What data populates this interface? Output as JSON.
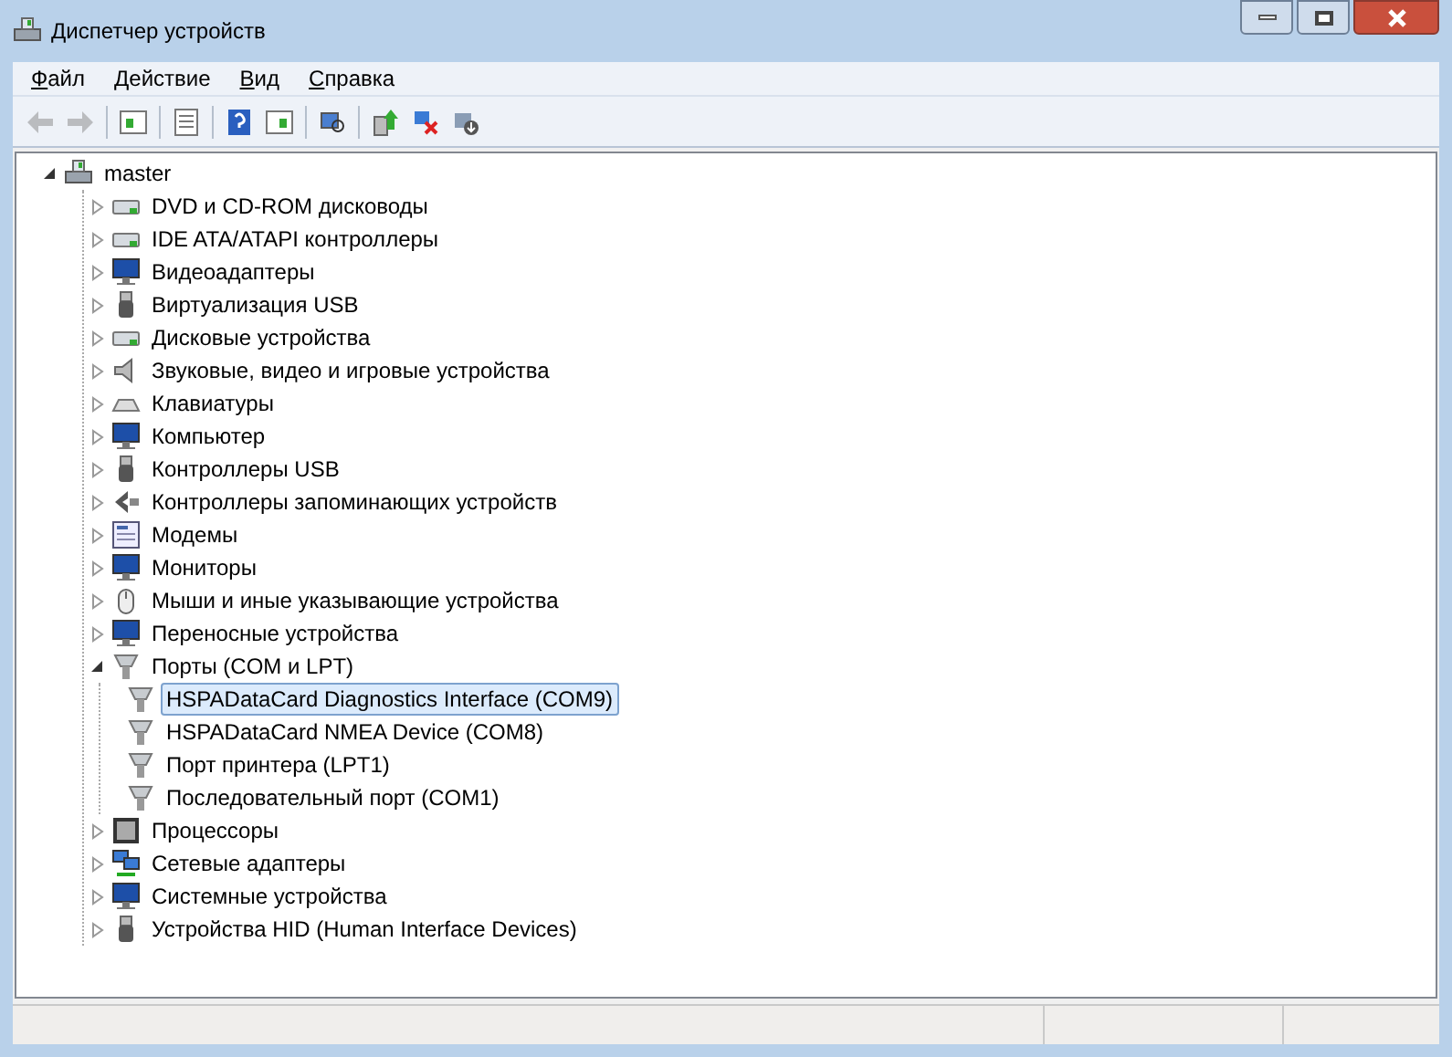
{
  "window": {
    "title": "Диспетчер устройств"
  },
  "menu": [
    {
      "label": "Файл"
    },
    {
      "label": "Действие"
    },
    {
      "label": "Вид"
    },
    {
      "label": "Справка"
    }
  ],
  "toolbar": [
    {
      "kind": "back",
      "disabled": true
    },
    {
      "kind": "forward",
      "disabled": true
    },
    {
      "kind": "sep"
    },
    {
      "kind": "tree"
    },
    {
      "kind": "sep"
    },
    {
      "kind": "properties"
    },
    {
      "kind": "sep"
    },
    {
      "kind": "help"
    },
    {
      "kind": "pane"
    },
    {
      "kind": "sep"
    },
    {
      "kind": "scan"
    },
    {
      "kind": "sep"
    },
    {
      "kind": "update"
    },
    {
      "kind": "disable"
    },
    {
      "kind": "uninstall"
    }
  ],
  "tree": {
    "label": "master",
    "kind": "computer",
    "expanded": true,
    "children": [
      {
        "label": "DVD и CD-ROM дисководы",
        "kind": "disk",
        "expanded": false,
        "selected": false
      },
      {
        "label": "IDE ATA/ATAPI контроллеры",
        "kind": "disk",
        "expanded": false,
        "selected": false
      },
      {
        "label": "Видеоадаптеры",
        "kind": "monitor",
        "expanded": false,
        "selected": false
      },
      {
        "label": "Виртуализация USB",
        "kind": "usb",
        "expanded": false,
        "selected": false
      },
      {
        "label": "Дисковые устройства",
        "kind": "disk",
        "expanded": false,
        "selected": false
      },
      {
        "label": "Звуковые, видео и игровые устройства",
        "kind": "speaker",
        "expanded": false,
        "selected": false
      },
      {
        "label": "Клавиатуры",
        "kind": "keyboard",
        "expanded": false,
        "selected": false
      },
      {
        "label": "Компьютер",
        "kind": "monitor",
        "expanded": false,
        "selected": false
      },
      {
        "label": "Контроллеры USB",
        "kind": "usb",
        "expanded": false,
        "selected": false
      },
      {
        "label": "Контроллеры запоминающих устройств",
        "kind": "storage",
        "expanded": false,
        "selected": false
      },
      {
        "label": "Модемы",
        "kind": "modem",
        "expanded": false,
        "selected": false
      },
      {
        "label": "Мониторы",
        "kind": "monitor",
        "expanded": false,
        "selected": false
      },
      {
        "label": "Мыши и иные указывающие устройства",
        "kind": "mouse",
        "expanded": false,
        "selected": false
      },
      {
        "label": "Переносные устройства",
        "kind": "monitor",
        "expanded": false,
        "selected": false
      },
      {
        "label": "Порты (COM и LPT)",
        "kind": "port",
        "expanded": true,
        "selected": false,
        "children": [
          {
            "label": "HSPADataCard Diagnostics Interface (COM9)",
            "kind": "port",
            "selected": true
          },
          {
            "label": "HSPADataCard NMEA Device (COM8)",
            "kind": "port",
            "selected": false
          },
          {
            "label": "Порт принтера (LPT1)",
            "kind": "port",
            "selected": false
          },
          {
            "label": "Последовательный порт (COM1)",
            "kind": "port",
            "selected": false
          }
        ]
      },
      {
        "label": "Процессоры",
        "kind": "chip",
        "expanded": false,
        "selected": false
      },
      {
        "label": "Сетевые адаптеры",
        "kind": "network",
        "expanded": false,
        "selected": false
      },
      {
        "label": "Системные устройства",
        "kind": "monitor",
        "expanded": false,
        "selected": false
      },
      {
        "label": "Устройства HID (Human Interface Devices)",
        "kind": "usb",
        "expanded": false,
        "selected": false
      }
    ]
  }
}
